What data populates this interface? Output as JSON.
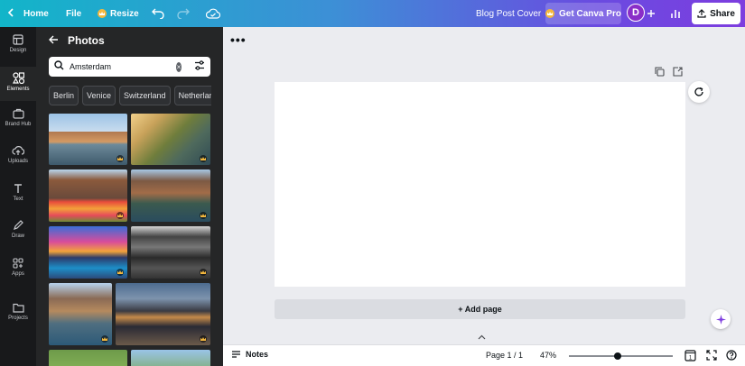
{
  "topbar": {
    "home_label": "Home",
    "file_label": "File",
    "resize_label": "Resize",
    "doc_title": "Blog Post Cover",
    "pro_label": "Get Canva Pro",
    "avatar_letter": "D",
    "share_label": "Share"
  },
  "rail": {
    "items": [
      {
        "label": "Design",
        "icon": "design-icon"
      },
      {
        "label": "Elements",
        "icon": "elements-icon"
      },
      {
        "label": "Brand Hub",
        "icon": "brand-hub-icon"
      },
      {
        "label": "Uploads",
        "icon": "uploads-icon"
      },
      {
        "label": "Text",
        "icon": "text-icon"
      },
      {
        "label": "Draw",
        "icon": "draw-icon"
      },
      {
        "label": "Apps",
        "icon": "apps-icon"
      },
      {
        "label": "Projects",
        "icon": "projects-icon"
      }
    ],
    "active": "Elements"
  },
  "panel": {
    "title": "Photos",
    "search_value": "Amsterdam",
    "chips": [
      "Berlin",
      "Venice",
      "Switzerland",
      "Netherlands"
    ]
  },
  "canvas": {
    "add_page_label": "+ Add page"
  },
  "bottombar": {
    "notes_label": "Notes",
    "page_label": "Page 1 / 1",
    "zoom_label": "47%",
    "zoom_value": 0.47,
    "page_count_badge": "1"
  }
}
